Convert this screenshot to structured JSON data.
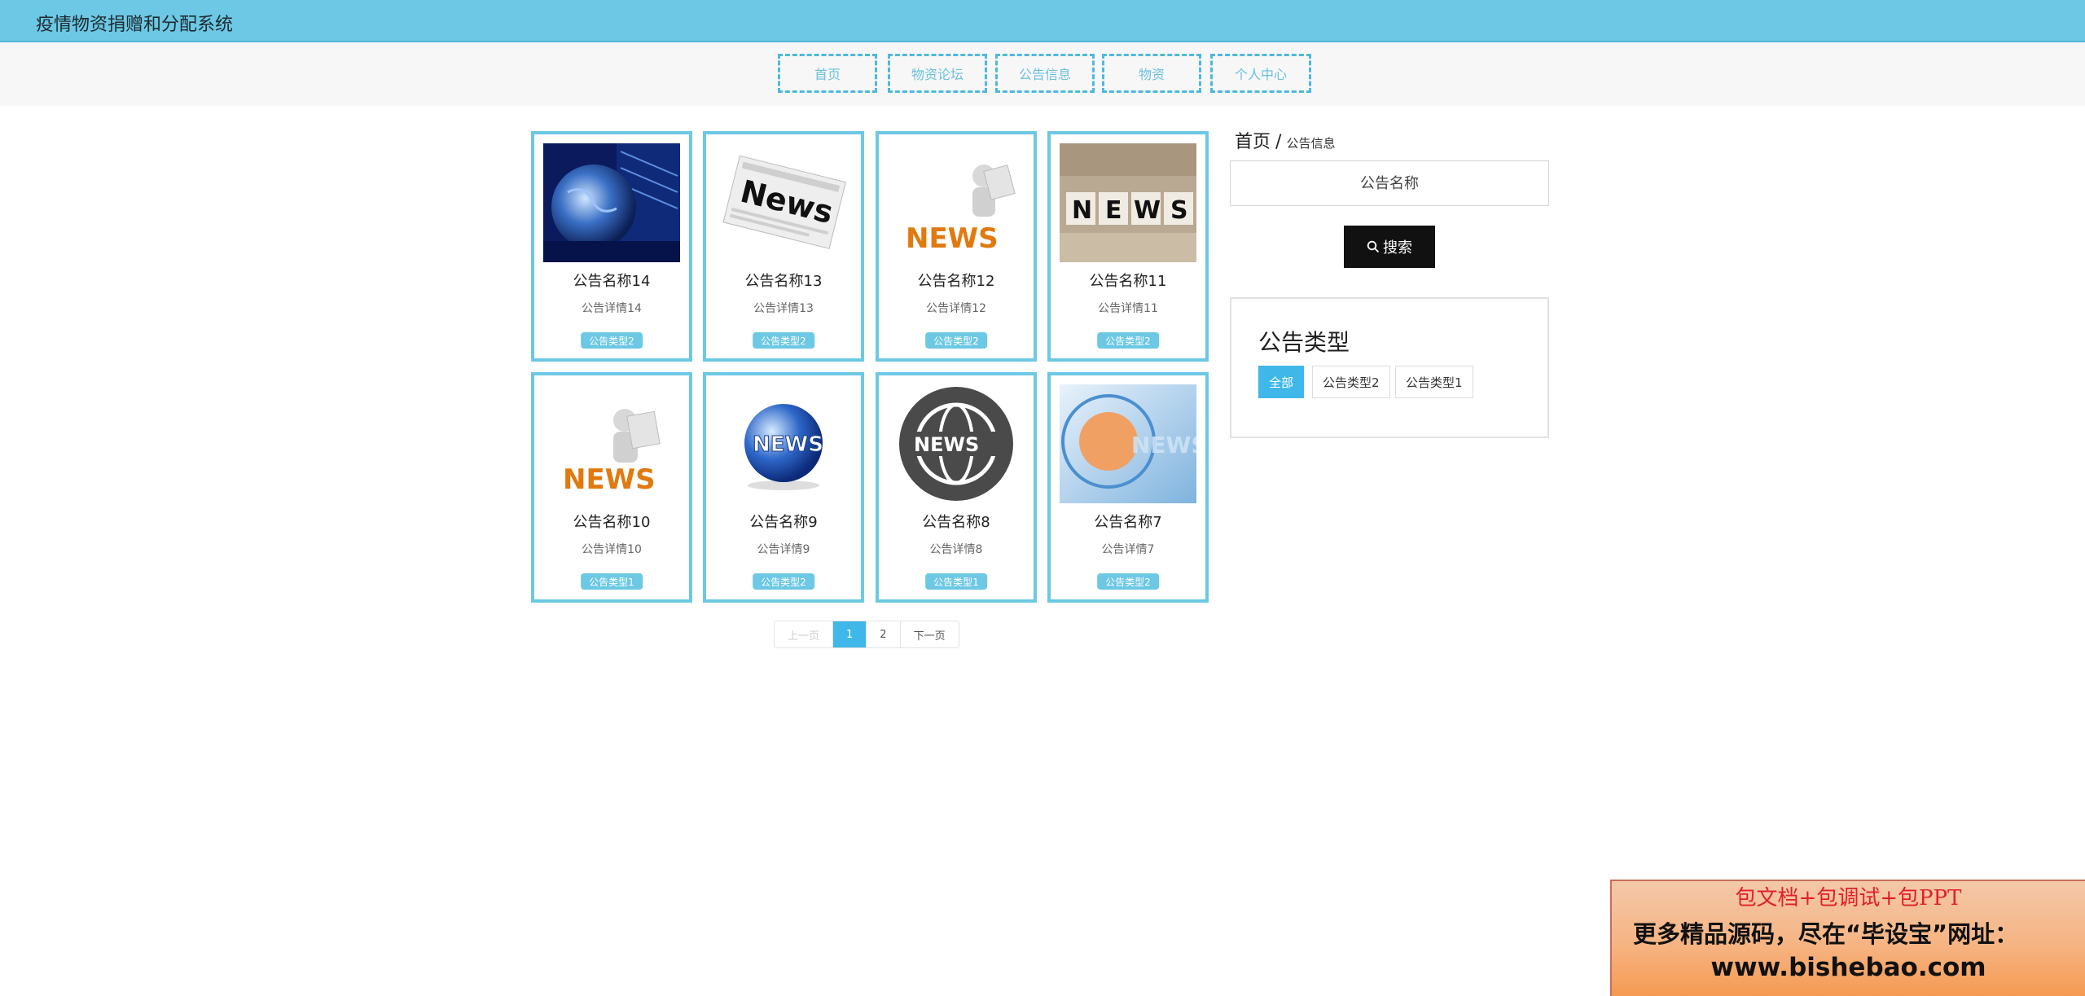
{
  "header": {
    "title": "疫情物资捐赠和分配系统"
  },
  "nav": {
    "items": [
      "首页",
      "物资论坛",
      "公告信息",
      "物资",
      "个人中心"
    ]
  },
  "cards": [
    {
      "name": "公告名称14",
      "detail": "公告详情14",
      "tag": "公告类型2",
      "image": "news-globe-tech-image"
    },
    {
      "name": "公告名称13",
      "detail": "公告详情13",
      "tag": "公告类型2",
      "image": "news-newspaper-image"
    },
    {
      "name": "公告名称12",
      "detail": "公告详情12",
      "tag": "公告类型2",
      "image": "news-3d-man-reading-image"
    },
    {
      "name": "公告名称11",
      "detail": "公告详情11",
      "tag": "公告类型2",
      "image": "news-letter-blocks-image"
    },
    {
      "name": "公告名称10",
      "detail": "公告详情10",
      "tag": "公告类型1",
      "image": "news-3d-man-reading-image"
    },
    {
      "name": "公告名称9",
      "detail": "公告详情9",
      "tag": "公告类型2",
      "image": "news-globe-image"
    },
    {
      "name": "公告名称8",
      "detail": "公告详情8",
      "tag": "公告类型1",
      "image": "news-globe-badge-image"
    },
    {
      "name": "公告名称7",
      "detail": "公告详情7",
      "tag": "公告类型2",
      "image": "news-abstract-blue-image"
    }
  ],
  "pagination": {
    "prev": "上一页",
    "pages": [
      "1",
      "2"
    ],
    "current": "1",
    "next": "下一页"
  },
  "breadcrumb": {
    "home": "首页",
    "separator": "/",
    "current": "公告信息"
  },
  "search": {
    "placeholder": "公告名称",
    "button": "搜索",
    "icon": "search-icon"
  },
  "type_filter": {
    "title": "公告类型",
    "options": [
      "全部",
      "公告类型2",
      "公告类型1"
    ],
    "selected": "全部"
  },
  "promo": {
    "line1": "包文档+包调试+包PPT",
    "line2": "更多精品源码，尽在“毕设宝”网址：",
    "line3": "www.bishebao.com"
  },
  "colors": {
    "accent": "#6cc8e4",
    "active": "#3fb7e8",
    "button": "#111111",
    "promo_red": "#e0202a"
  }
}
